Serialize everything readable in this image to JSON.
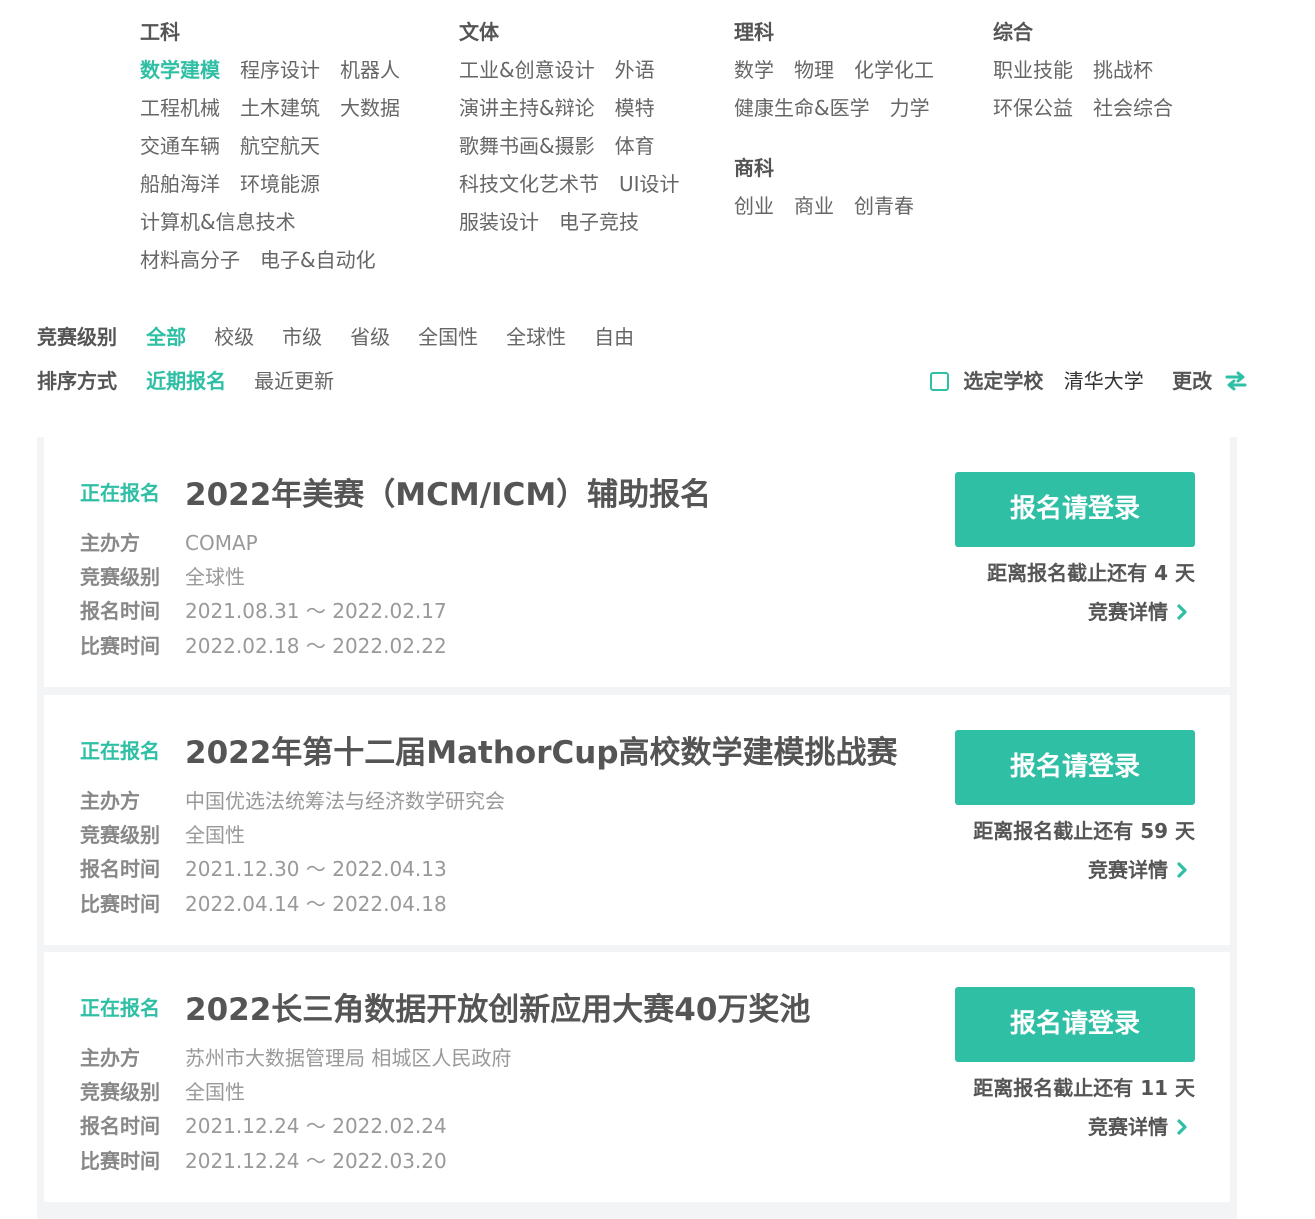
{
  "categories": [
    {
      "heading": "工科",
      "rows": [
        [
          "数学建模",
          "程序设计",
          "机器人"
        ],
        [
          "工程机械",
          "土木建筑",
          "大数据"
        ],
        [
          "交通车辆",
          "航空航天"
        ],
        [
          "船舶海洋",
          "环境能源"
        ],
        [
          "计算机&信息技术"
        ],
        [
          "材料高分子",
          "电子&自动化"
        ]
      ],
      "active": "数学建模"
    },
    {
      "heading": "文体",
      "rows": [
        [
          "工业&创意设计",
          "外语"
        ],
        [
          "演讲主持&辩论",
          "模特"
        ],
        [
          "歌舞书画&摄影",
          "体育"
        ],
        [
          "科技文化艺术节",
          "UI设计"
        ],
        [
          "服装设计",
          "电子竞技"
        ]
      ]
    },
    {
      "heading": "理科",
      "rows": [
        [
          "数学",
          "物理",
          "化学化工"
        ],
        [
          "健康生命&医学",
          "力学"
        ]
      ],
      "sub_heading": "商科",
      "sub_rows": [
        [
          "创业",
          "商业",
          "创青春"
        ]
      ]
    },
    {
      "heading": "综合",
      "rows": [
        [
          "职业技能",
          "挑战杯"
        ],
        [
          "环保公益",
          "社会综合"
        ]
      ]
    }
  ],
  "filters": {
    "level": {
      "label": "竞赛级别",
      "options": [
        "全部",
        "校级",
        "市级",
        "省级",
        "全国性",
        "全球性",
        "自由"
      ],
      "active": "全部"
    },
    "sort": {
      "label": "排序方式",
      "options": [
        "近期报名",
        "最近更新"
      ],
      "active": "近期报名"
    }
  },
  "school": {
    "label": "选定学校",
    "name": "清华大学",
    "change_label": "更改"
  },
  "colors": {
    "accent": "#2fbfa5",
    "text": "#555555",
    "muted": "#999999",
    "list_bg": "#f3f4f6"
  },
  "competitions": [
    {
      "status": "正在报名",
      "title": "2022年美赛（MCM/ICM）辅助报名",
      "organizer_label": "主办方",
      "organizer": "COMAP",
      "level_label": "竞赛级别",
      "level": "全球性",
      "signup_label": "报名时间",
      "signup_time": "2021.08.31 ～ 2022.02.17",
      "contest_label": "比赛时间",
      "contest_time": "2022.02.18 ～ 2022.02.22",
      "button": "报名请登录",
      "deadline": "距离报名截止还有 4 天",
      "detail": "竞赛详情"
    },
    {
      "status": "正在报名",
      "title": "2022年第十二届MathorCup高校数学建模挑战赛",
      "organizer_label": "主办方",
      "organizer": "中国优选法统筹法与经济数学研究会",
      "level_label": "竞赛级别",
      "level": "全国性",
      "signup_label": "报名时间",
      "signup_time": "2021.12.30 ～ 2022.04.13",
      "contest_label": "比赛时间",
      "contest_time": "2022.04.14 ～ 2022.04.18",
      "button": "报名请登录",
      "deadline": "距离报名截止还有 59 天",
      "detail": "竞赛详情"
    },
    {
      "status": "正在报名",
      "title": "2022长三角数据开放创新应用大赛40万奖池",
      "organizer_label": "主办方",
      "organizer": "苏州市大数据管理局 相城区人民政府",
      "level_label": "竞赛级别",
      "level": "全国性",
      "signup_label": "报名时间",
      "signup_time": "2021.12.24 ～ 2022.02.24",
      "contest_label": "比赛时间",
      "contest_time": "2021.12.24 ～ 2022.03.20",
      "button": "报名请登录",
      "deadline": "距离报名截止还有 11 天",
      "detail": "竞赛详情"
    }
  ]
}
